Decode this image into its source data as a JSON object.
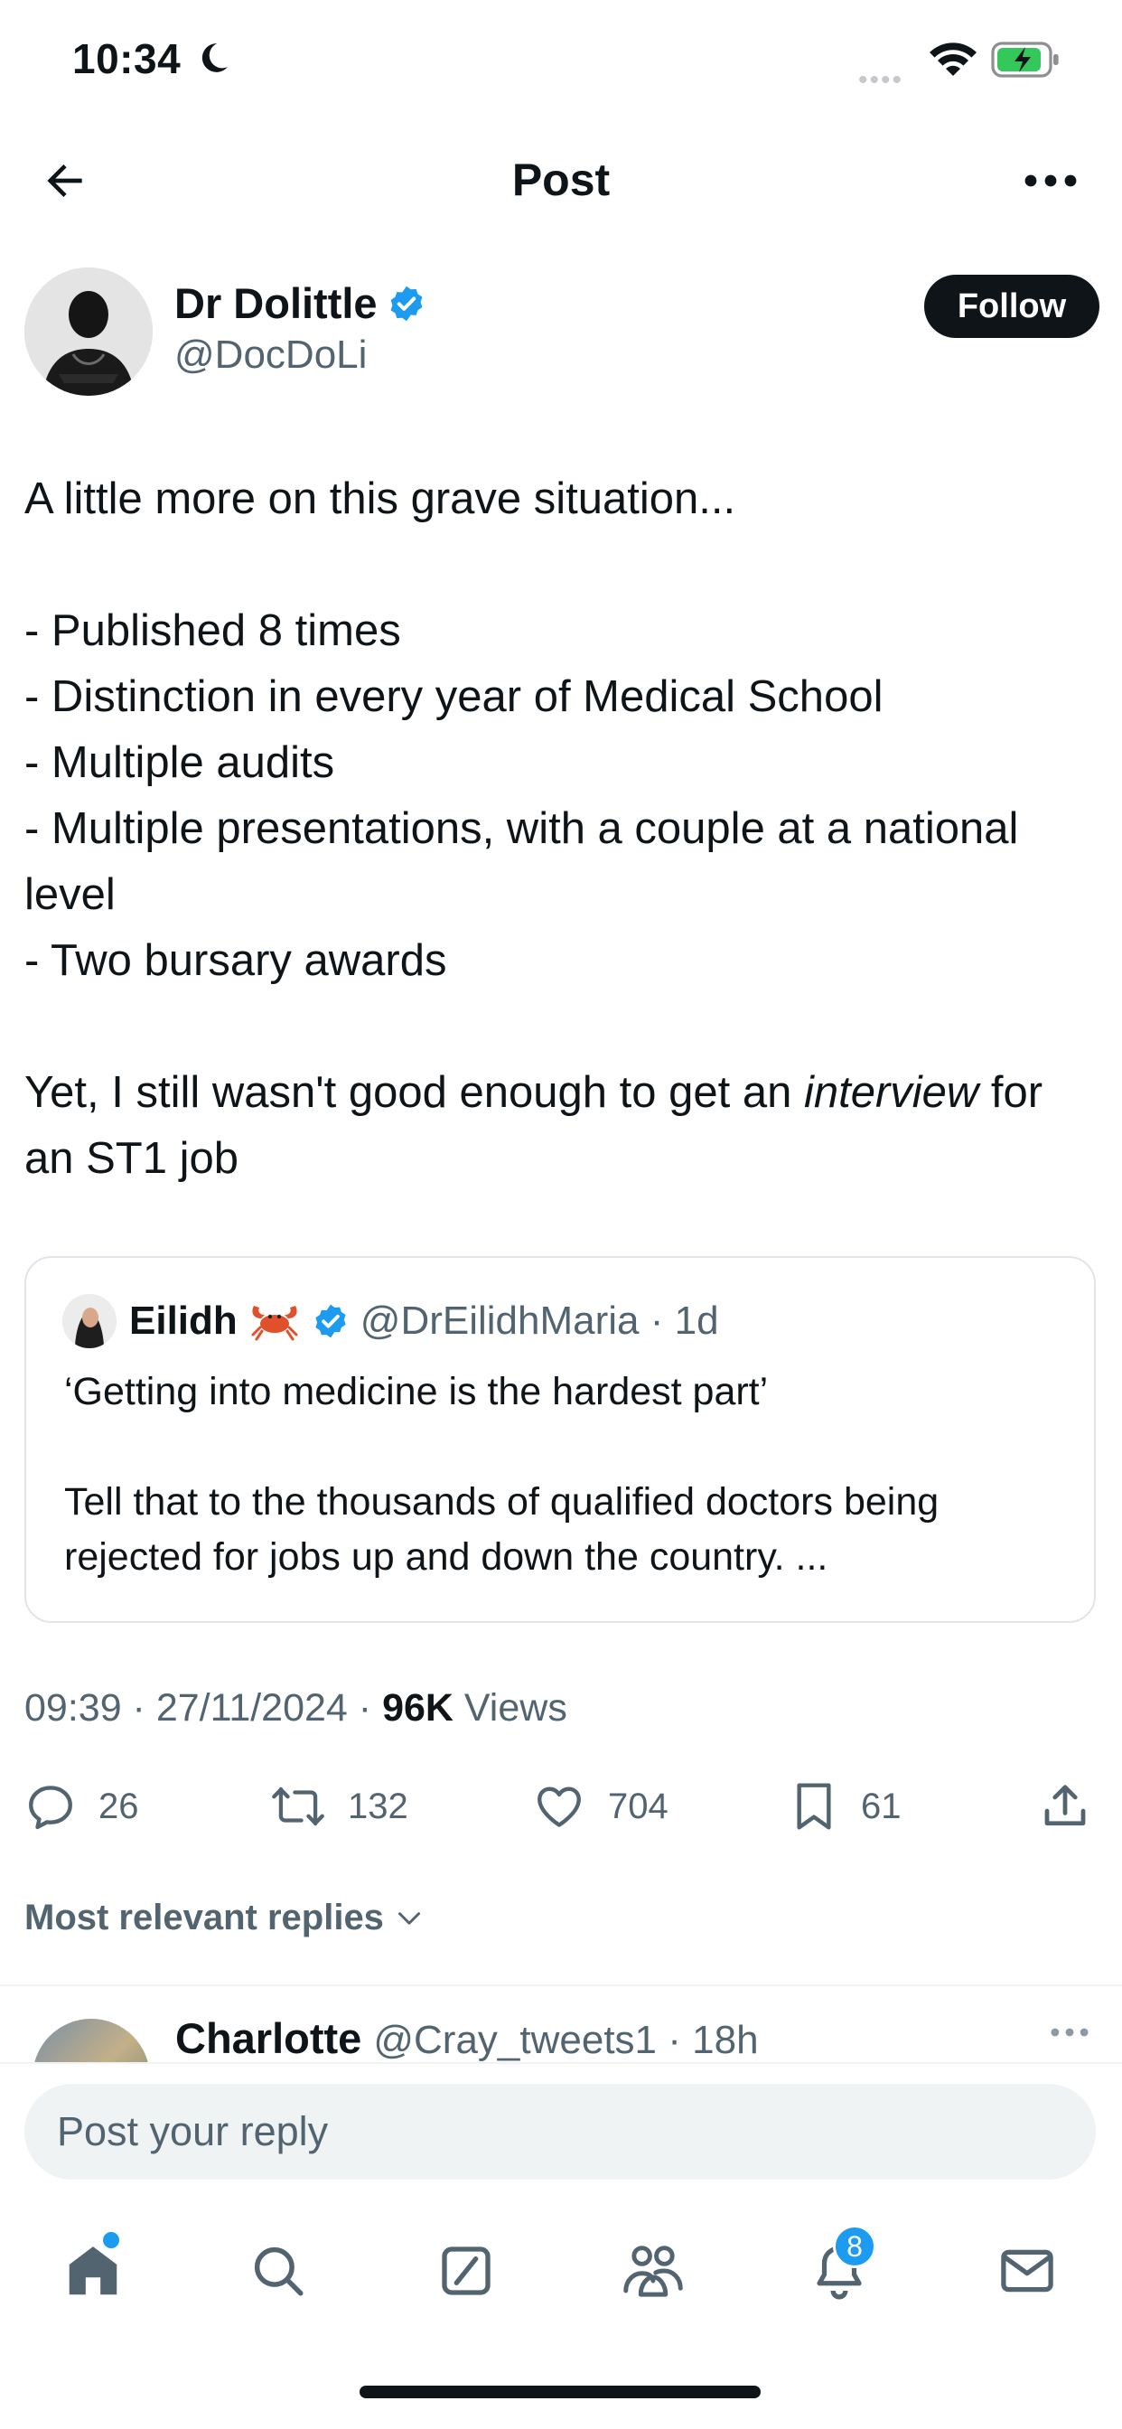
{
  "status_bar": {
    "time": "10:34"
  },
  "nav": {
    "title": "Post"
  },
  "post": {
    "author_name": "Dr Dolittle",
    "author_handle": "@DocDoLi",
    "follow_label": "Follow",
    "text": {
      "line1": "A little more on this grave situation...",
      "bullets": [
        "- Published 8 times",
        "- Distinction in every year of Medical School",
        "- Multiple audits",
        "- Multiple presentations, with a couple at a national level",
        "- Two bursary awards"
      ],
      "closing_before": "Yet, I still wasn't good enough to get an ",
      "closing_emphasis": "interview",
      "closing_after": " for an ST1 job"
    },
    "quote": {
      "name": "Eilidh",
      "handle_time": "@DrEilidhMaria · 1d",
      "line1": "‘Getting into medicine is the hardest part’",
      "line2": "Tell that to the thousands of qualified doctors being rejected for jobs up and down the country. ..."
    },
    "meta": {
      "datetime": "09:39 · 27/11/2024 · ",
      "views_count": "96K",
      "views_label": " Views"
    },
    "stats": {
      "replies": "26",
      "reposts": "132",
      "likes": "704",
      "bookmarks": "61"
    }
  },
  "sort_label": "Most relevant replies",
  "reply_preview": {
    "name": "Charlotte",
    "handle_time": "@Cray_tweets1 · 18h"
  },
  "composer": {
    "placeholder": "Post your reply"
  },
  "tabs": {
    "notifications_badge": "8"
  },
  "colors": {
    "accent": "#1d9bf0",
    "text": "#0f1419",
    "secondary": "#536471",
    "follow_bg": "#0f1419",
    "battery": "#34c759"
  }
}
